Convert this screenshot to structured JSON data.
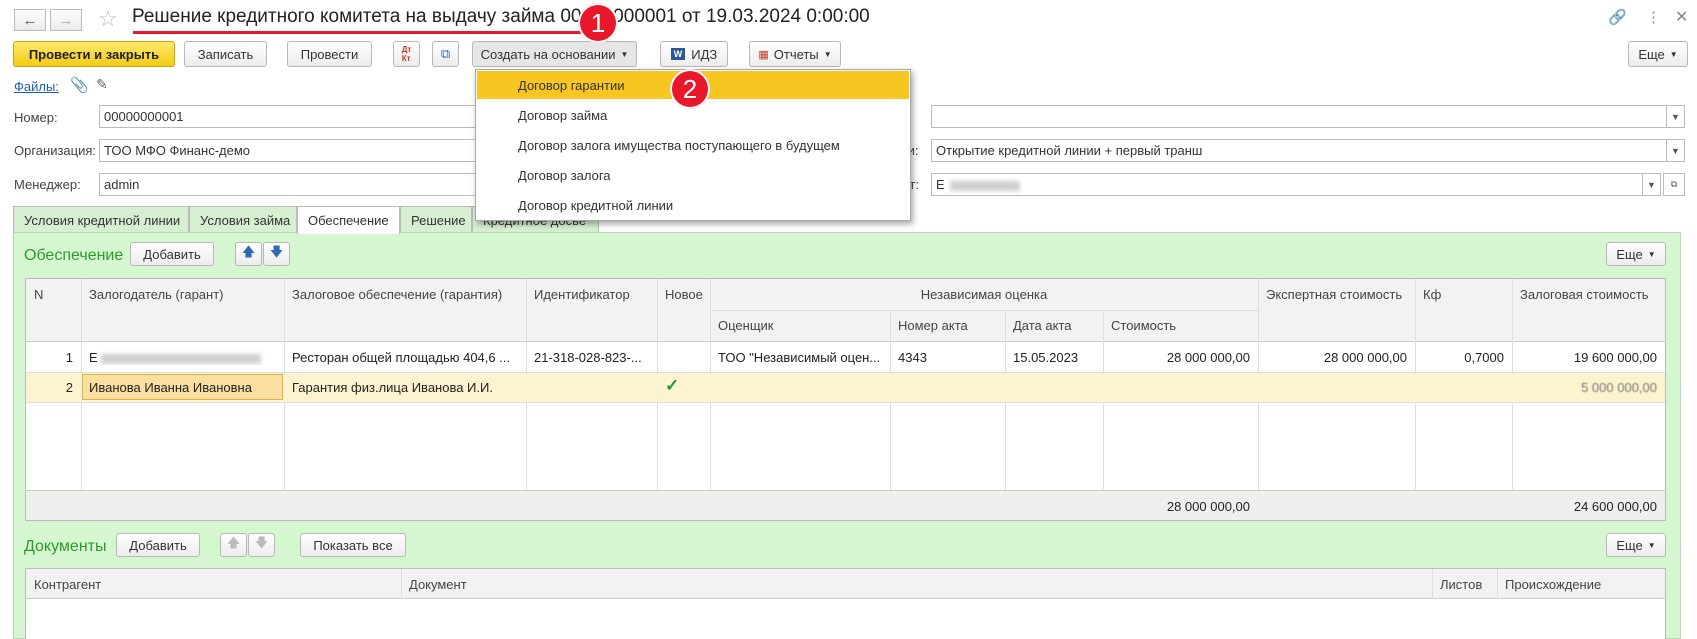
{
  "window": {
    "title": "Решение кредитного комитета на выдачу займа 00000000001 от 19.03.2024 0:00:00"
  },
  "toolbar": {
    "post_close": "Провести и закрыть",
    "save": "Записать",
    "post": "Провести",
    "create_based": "Создать на основании",
    "idz": "ИДЗ",
    "reports": "Отчеты",
    "more": "Еще"
  },
  "files_link": "Файлы:",
  "form": {
    "number_label": "Номер:",
    "number_value": "00000000001",
    "org_label": "Организация:",
    "org_value": "ТОО МФО Финанс-демо",
    "manager_label": "Менеджер:",
    "manager_value": "admin",
    "right_field1_value": "",
    "right_label2": "вки:",
    "right_field2_value": "Открытие кредитной линии + первый транш",
    "right_label3": "ент:",
    "right_field3_value": "Е"
  },
  "tabs": [
    {
      "label": "Условия кредитной линии"
    },
    {
      "label": "Условия займа"
    },
    {
      "label": "Обеспечение"
    },
    {
      "label": "Решение"
    },
    {
      "label": "Кредитное досье"
    }
  ],
  "collateral": {
    "title": "Обеспечение",
    "add": "Добавить",
    "more": "Еще",
    "columns": {
      "n": "N",
      "pledger": "Залогодатель (гарант)",
      "collateral": "Залоговое обеспечение (гарантия)",
      "id": "Идентификатор",
      "new": "Новое",
      "indep": "Независимая оценка",
      "appraiser": "Оценщик",
      "act_no": "Номер акта",
      "act_date": "Дата акта",
      "cost": "Стоимость",
      "expert": "Экспертная стоимость",
      "kf": "Кф",
      "pledge": "Залоговая стоимость"
    },
    "rows": [
      {
        "n": "1",
        "pledger": "Е",
        "collateral": "Ресторан общей площадью 404,6 ...",
        "id": "21-318-028-823-...",
        "new": "",
        "appraiser": "ТОО \"Независимый оцен...",
        "act_no": "4343",
        "act_date": "15.05.2023",
        "cost": "28 000 000,00",
        "expert": "28 000 000,00",
        "kf": "0,7000",
        "pledge": "19 600 000,00"
      },
      {
        "n": "2",
        "pledger": "Иванова Иванна Ивановна",
        "collateral": "Гарантия физ.лица Иванова И.И.",
        "id": "",
        "new": "✓",
        "appraiser": "",
        "act_no": "",
        "act_date": "",
        "cost": "",
        "expert": "",
        "kf": "",
        "pledge": "5 000 000,00"
      }
    ],
    "totals": {
      "cost": "28 000 000,00",
      "pledge": "24 600 000,00"
    }
  },
  "documents": {
    "title": "Документы",
    "add": "Добавить",
    "show_all": "Показать все",
    "more": "Еще",
    "columns": {
      "counterparty": "Контрагент",
      "document": "Документ",
      "sheets": "Листов",
      "origin": "Происхождение"
    }
  },
  "popup": {
    "items": [
      {
        "label": "Договор гарантии"
      },
      {
        "label": "Договор займа"
      },
      {
        "label": "Договор залога имущества поступающего в будущем"
      },
      {
        "label": "Договор залога"
      },
      {
        "label": "Договор кредитной линии"
      }
    ]
  },
  "badges": {
    "one": "1",
    "two": "2"
  },
  "colors": {
    "accent_green": "#2e9a2e",
    "panel_green": "#d4f7d0",
    "highlight_yellow": "#f7c621",
    "badge_red": "#e8172a",
    "row_selected": "#fdf3d0"
  }
}
